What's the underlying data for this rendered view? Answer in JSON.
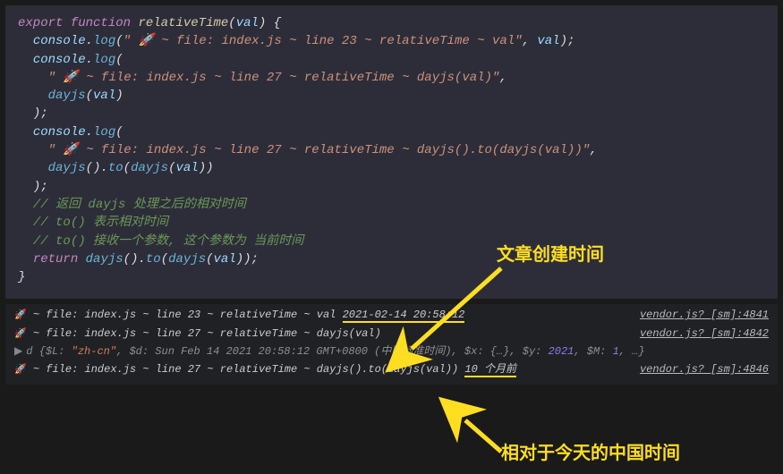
{
  "code": {
    "l1": {
      "kw1": "export",
      "kw2": "function",
      "fn": "relativeTime",
      "param": "val"
    },
    "l2": {
      "obj": "console",
      "m": "log",
      "str": "\" 🚀 ~ file: index.js ~ line 23 ~ relativeTime ~ val\"",
      "arg": "val"
    },
    "l3": {
      "obj": "console",
      "m": "log"
    },
    "l4": {
      "str": "\" 🚀 ~ file: index.js ~ line 27 ~ relativeTime ~ dayjs(val)\""
    },
    "l5": {
      "fn": "dayjs",
      "arg": "val"
    },
    "l6": ");",
    "l7": {
      "obj": "console",
      "m": "log"
    },
    "l8": {
      "str": "\" 🚀 ~ file: index.js ~ line 27 ~ relativeTime ~ dayjs().to(dayjs(val))\""
    },
    "l9": {
      "fn1": "dayjs",
      "m": "to",
      "fn2": "dayjs",
      "arg": "val"
    },
    "l10": ");",
    "l11": "// 返回 dayjs 处理之后的相对时间",
    "l12": "// to() 表示相对时间",
    "l13": "// to() 接收一个参数, 这个参数为 当前时间",
    "l14": {
      "kw": "return",
      "fn1": "dayjs",
      "m": "to",
      "fn2": "dayjs",
      "arg": "val"
    }
  },
  "annotations": {
    "a1": "文章创建时间",
    "a2": "相对于今天的中国时间"
  },
  "console": {
    "r1": {
      "pre": " ~ file: index.js ~ line 23 ~ relativeTime ~ val ",
      "val": "2021-02-14 20:58:12",
      "src": "vendor.js? [sm]:4841"
    },
    "r2": {
      "pre": " ~ file: index.js ~ line 27 ~ relativeTime ~ dayjs(val)",
      "src": "vendor.js? [sm]:4842"
    },
    "r3": {
      "pre": "d ",
      "body1": "{$L: ",
      "str": "\"zh-cn\"",
      "body2": ", $d: Sun Feb 14 2021 20:58:12 GMT+0800 (中国标准时间), $x: {…}, $y: ",
      "num1": "2021",
      "body3": ", $M: ",
      "num2": "1",
      "body4": ", …}"
    },
    "r4": {
      "pre": " ~ file: index.js ~ line 27 ~ relativeTime ~ dayjs().to(dayjs(val)) ",
      "val": "10 个月前",
      "src": "vendor.js? [sm]:4846"
    }
  }
}
